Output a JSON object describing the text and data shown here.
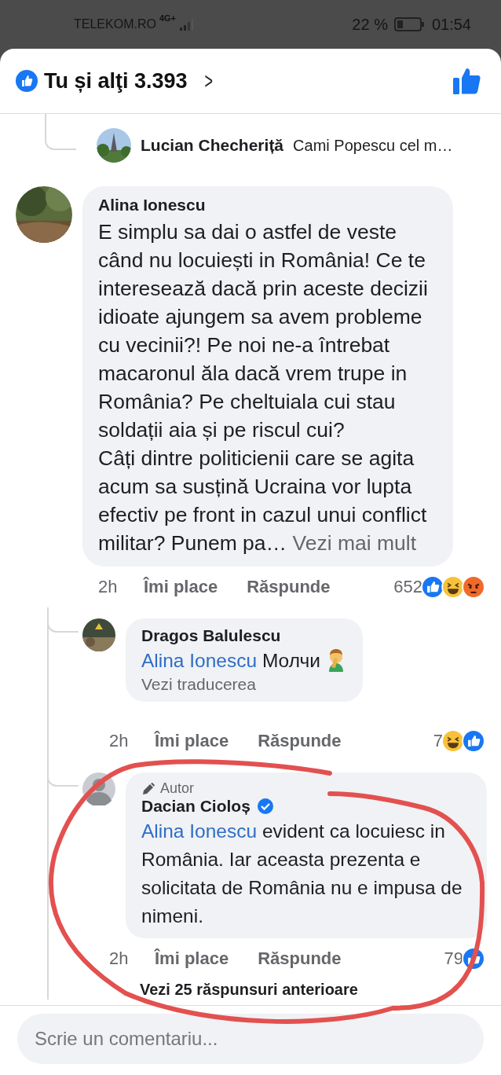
{
  "status_bar": {
    "carrier": "TELEKOM.RO",
    "network": "4G+",
    "battery": "22 %",
    "time": "01:54"
  },
  "header": {
    "likes": "Tu și alţi 3.393",
    "chevron": ">"
  },
  "comments": [
    {
      "kind": "inline",
      "name": "Lucian Checheriță",
      "text": "Cami Popescu cel m…"
    },
    {
      "kind": "comment",
      "name": "Alina Ionescu",
      "text": "E simplu sa dai o astfel de veste când nu locuiești in România! Ce te interesează dacă prin aceste decizii idioate ajungem sa avem probleme cu vecinii?! Pe noi ne-a întrebat macaronul ăla dacă vrem trupe in România? Pe cheltuiala cui stau soldații aia și pe riscul cui?\nCâți dintre politicienii care se agita acum sa susțină Ucraina vor lupta efectiv pe front in cazul unui conflict militar? Punem pa…",
      "see_more": "Vezi mai mult",
      "time": "2h",
      "like": "Îmi place",
      "reply": "Răspunde",
      "reaction_count": "652",
      "reactions": [
        {
          "kind": "like"
        },
        {
          "kind": "haha"
        },
        {
          "kind": "angry"
        }
      ],
      "replies": [
        {
          "kind": "reply",
          "name": "Dragos Balulescu",
          "mention": "Alina Ionescu",
          "text": "Молчи",
          "emoji": true,
          "see_translation": "Vezi traducerea",
          "time": "2h",
          "like": "Îmi place",
          "reply": "Răspunde",
          "reaction_count": "7",
          "reactions": [
            {
              "kind": "haha"
            },
            {
              "kind": "like"
            }
          ]
        },
        {
          "kind": "reply",
          "author_badge": "Autor",
          "verified": true,
          "name": "Dacian Cioloș",
          "mention": "Alina Ionescu",
          "text": "evident ca locuiesc in România. Iar aceasta prezenta e solicitata de România nu e impusa de nimeni.",
          "time": "2h",
          "like": "Îmi place",
          "reply": "Răspunde",
          "reaction_count": "79",
          "reactions": [
            {
              "kind": "like"
            }
          ],
          "more_replies": "Vezi 25 răspunsuri anterioare"
        }
      ]
    }
  ],
  "composer": {
    "placeholder": "Scrie un comentariu..."
  }
}
